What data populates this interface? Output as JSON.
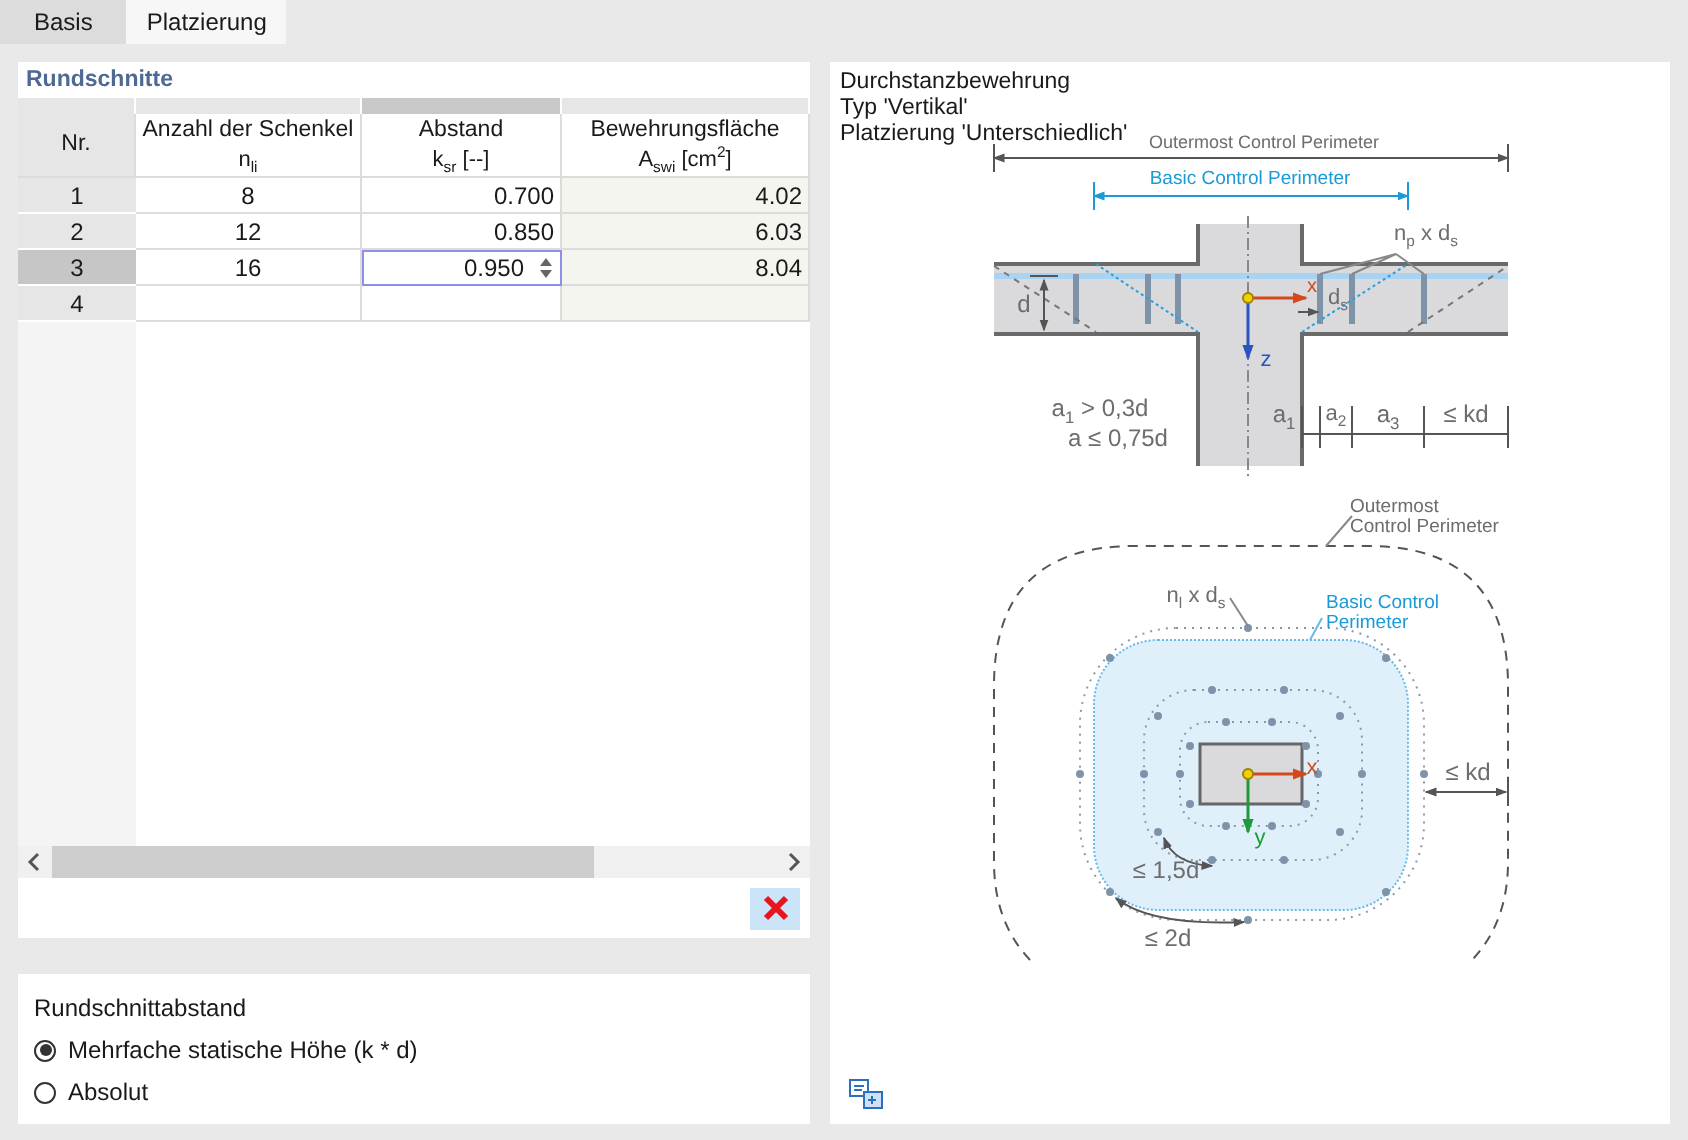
{
  "tabs": [
    {
      "label": "Basis",
      "selected": false
    },
    {
      "label": "Platzierung",
      "selected": true
    }
  ],
  "rundschnitte": {
    "title": "Rundschnitte",
    "columns": [
      {
        "label": "Nr.",
        "highlighted": false
      },
      {
        "label": "Anzahl der Schenkel",
        "unit": "n$_{li}$",
        "highlighted": false
      },
      {
        "label": "Abstand",
        "unit": "k$_{sr}$ [--]",
        "highlighted": true
      },
      {
        "label": "Bewehrungsfläche",
        "unit": "A$_{swi}$ [cm$^{2}$]",
        "highlighted": false
      }
    ],
    "rows": [
      {
        "nr": "1",
        "legs": "8",
        "spacing": "0.700",
        "area": "4.02",
        "selected": false,
        "editing": false
      },
      {
        "nr": "2",
        "legs": "12",
        "spacing": "0.850",
        "area": "6.03",
        "selected": false,
        "editing": false
      },
      {
        "nr": "3",
        "legs": "16",
        "spacing": "0.950",
        "area": "8.04",
        "selected": true,
        "editing": true
      },
      {
        "nr": "4",
        "selected": false,
        "editing": false
      }
    ]
  },
  "spacing_mode": {
    "title": "Rundschnittabstand",
    "options": [
      {
        "label": "Mehrfache statische Höhe (k * d)",
        "selected": true
      },
      {
        "label": "Absolut",
        "selected": false
      }
    ]
  },
  "preview": {
    "lines": [
      "Durchstanzbewehrung",
      "Typ 'Vertikal'",
      "Platzierung 'Unterschiedlich'"
    ],
    "section_labels": [
      "Outermost Control Perimeter",
      "Basic Control Perimeter",
      "n$_{p}$ x d$_{s}$",
      "d",
      "x",
      "d$_{s}$",
      "z",
      "a$_{1}$ > 0,3d",
      "a ≤ 0,75d",
      "a$_{1}$",
      "a$_{2}$",
      "a$_{3}$",
      "≤ kd"
    ],
    "plan_labels": [
      "Outermost Control Perimeter",
      "n$_{l}$ x d$_{s}$",
      "Basic Control Perimeter",
      "x",
      "y",
      "≤ kd",
      "≤ 1,5d",
      "≤ 2d"
    ]
  }
}
